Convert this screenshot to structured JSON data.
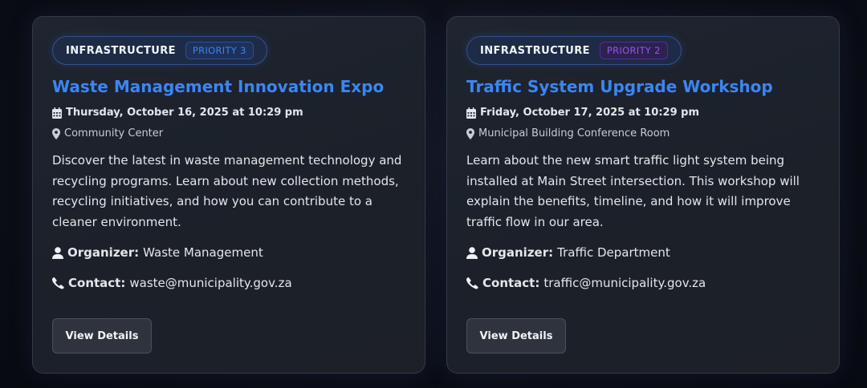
{
  "events": [
    {
      "category": "INFRASTRUCTURE",
      "priority": "PRIORITY 3",
      "title": "Waste Management Innovation Expo",
      "date": "Thursday, October 16, 2025 at 10:29 pm",
      "location": "Community Center",
      "description": "Discover the latest in waste management technology and recycling programs. Learn about new collection methods, recycling initiatives, and how you can contribute to a cleaner environment.",
      "organizer_label": "Organizer:",
      "organizer": "Waste Management",
      "contact_label": "Contact:",
      "contact": "waste@municipality.gov.za",
      "button": "View Details"
    },
    {
      "category": "INFRASTRUCTURE",
      "priority": "PRIORITY 2",
      "title": "Traffic System Upgrade Workshop",
      "date": "Friday, October 17, 2025 at 10:29 pm",
      "location": "Municipal Building Conference Room",
      "description": "Learn about the new smart traffic light system being installed at Main Street intersection. This workshop will explain the benefits, timeline, and how it will improve traffic flow in our area.",
      "organizer_label": "Organizer:",
      "organizer": "Traffic Department",
      "contact_label": "Contact:",
      "contact": "traffic@municipality.gov.za",
      "button": "View Details"
    }
  ],
  "colors": {
    "title": "#3b86f5",
    "priority3": "#3d82f0",
    "priority2": "#9a53e8",
    "card_bg": "#1f2530"
  },
  "icons": [
    "calendar-icon",
    "map-marker-icon",
    "user-icon",
    "phone-icon"
  ]
}
